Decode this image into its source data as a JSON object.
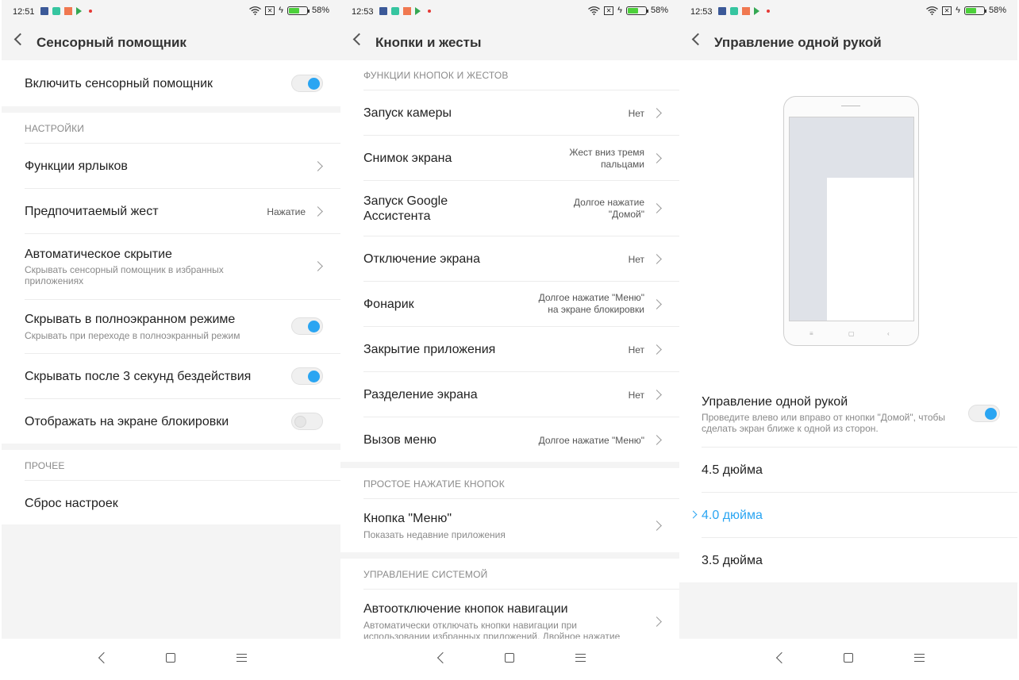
{
  "status": {
    "time_p1": "12:51",
    "time_p2": "12:53",
    "time_p3": "12:53",
    "battery": "58%",
    "battery_level": 0.58,
    "icons": [
      "facebook-icon",
      "slack-icon",
      "mail-icon",
      "play-store-icon",
      "notification-dot-icon",
      "wifi-icon",
      "sim-icon",
      "charging-icon",
      "battery-icon"
    ]
  },
  "panel1": {
    "title": "Сенсорный помощник",
    "enable_label": "Включить сенсорный помощник",
    "enable_on": true,
    "settings_label": "НАСТРОЙКИ",
    "shortcut_functions": "Функции ярлыков",
    "preferred_gesture": "Предпочитаемый жест",
    "preferred_gesture_value": "Нажатие",
    "auto_hide": "Автоматическое скрытие",
    "auto_hide_sub": "Скрывать сенсорный помощник в избранных приложениях",
    "hide_fullscreen": "Скрывать в полноэкранном режиме",
    "hide_fullscreen_sub": "Скрывать при переходе в полноэкранный режим",
    "hide_fullscreen_on": true,
    "hide_idle": "Скрывать после 3 секунд бездействия",
    "hide_idle_on": true,
    "show_lockscreen": "Отображать на экране блокировки",
    "show_lockscreen_on": false,
    "other_label": "ПРОЧЕЕ",
    "reset": "Сброс настроек"
  },
  "panel2": {
    "title": "Кнопки и жесты",
    "section1": "ФУНКЦИИ КНОПОК И ЖЕСТОВ",
    "items": [
      {
        "title": "Запуск камеры",
        "value": "Нет"
      },
      {
        "title": "Снимок экрана",
        "value": "Жест вниз тремя\nпальцами"
      },
      {
        "title": "Запуск Google\nАссистента",
        "value": "Долгое нажатие\n\"Домой\""
      },
      {
        "title": "Отключение экрана",
        "value": "Нет"
      },
      {
        "title": "Фонарик",
        "value": "Долгое нажатие \"Меню\"\nна экране блокировки"
      },
      {
        "title": "Закрытие приложения",
        "value": "Нет"
      },
      {
        "title": "Разделение экрана",
        "value": "Нет"
      },
      {
        "title": "Вызов меню",
        "value": "Долгое нажатие \"Меню\""
      }
    ],
    "section2": "ПРОСТОЕ НАЖАТИЕ КНОПОК",
    "menu_button": "Кнопка \"Меню\"",
    "menu_button_sub": "Показать недавние приложения",
    "section3": "УПРАВЛЕНИЕ СИСТЕМОЙ",
    "auto_off_nav": "Автоотключение кнопок навигации",
    "auto_off_nav_sub": "Автоматически отключать кнопки навигации при использовании избранных приложений. Двойное нажатие"
  },
  "panel3": {
    "title": "Управление одной рукой",
    "one_hand_label": "Управление одной рукой",
    "one_hand_sub": "Проведите влево или вправо от кнопки \"Домой\", чтобы сделать экран ближе к одной из сторон.",
    "one_hand_on": true,
    "sizes": [
      "4.5 дюйма",
      "4.0 дюйма",
      "3.5 дюйма"
    ],
    "selected_size": "4.0 дюйма",
    "accent": "#2aa5f2"
  }
}
